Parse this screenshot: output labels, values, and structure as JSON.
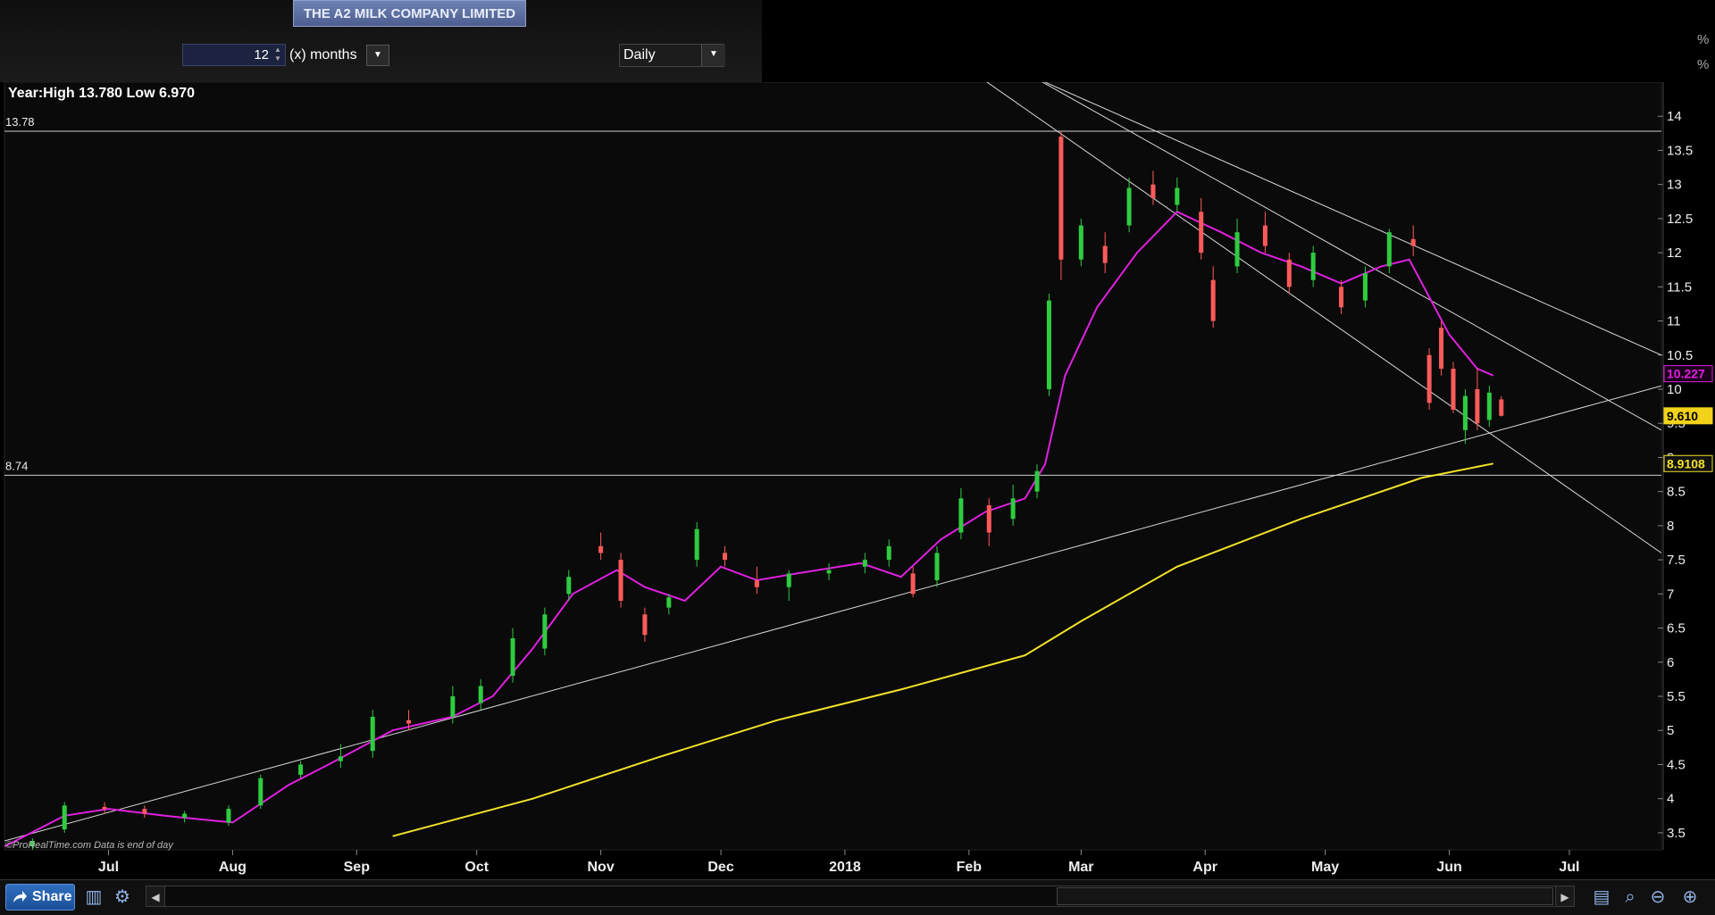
{
  "header": {
    "title": "THE A2 MILK COMPANY LIMITED",
    "period_value": "12",
    "period_unit_label": "(x) months",
    "interval": "Daily",
    "pct_markers": [
      "%",
      "%"
    ]
  },
  "toolbar": {
    "share_label": "Share",
    "icons": [
      "chart-tools-icon",
      "indicator-icon",
      "zoom-fit-icon",
      "zoom-out-icon",
      "zoom-in-icon"
    ]
  },
  "colors": {
    "background": "#0a0a0a",
    "up_candle": "#2ecc40",
    "down_candle": "#ff5a5a",
    "ma_short": "#e020e0",
    "ma_long": "#f2e22a",
    "trendline": "#d8d8d8"
  },
  "chart_data": {
    "type": "candlestick",
    "title": "Year:High 13.780 Low 6.970",
    "watermark": "©ProRealTime.com Data is end of day",
    "year_high": 13.78,
    "year_low": 6.97,
    "ylim": [
      3.25,
      14.5
    ],
    "y_ticks": [
      3.5,
      4,
      4.5,
      5,
      5.5,
      6,
      6.5,
      7,
      7.5,
      8,
      8.5,
      9,
      9.5,
      10,
      10.5,
      11,
      11.5,
      12,
      12.5,
      13,
      13.5,
      14
    ],
    "y_tick_labels": [
      "3.5",
      "4",
      "4.5",
      "5",
      "5.5",
      "6",
      "6.5",
      "7",
      "7.5",
      "8",
      "8.5",
      "9",
      "9.5",
      "10",
      "10.5",
      "11",
      "11.5",
      "12",
      "12.5",
      "13",
      "13.5",
      "14"
    ],
    "x_labels": [
      "Jul",
      "Aug",
      "Sep",
      "Oct",
      "Nov",
      "Dec",
      "2018",
      "Feb",
      "Mar",
      "Apr",
      "May",
      "Jun",
      "Jul"
    ],
    "x_label_dates": [
      "2017-07-01",
      "2017-08-01",
      "2017-09-01",
      "2017-10-01",
      "2017-11-01",
      "2017-12-01",
      "2018-01-01",
      "2018-02-01",
      "2018-03-01",
      "2018-04-01",
      "2018-05-01",
      "2018-06-01",
      "2018-07-01"
    ],
    "x_range": [
      "2017-06-05",
      "2018-07-24"
    ],
    "horizontal_levels": [
      {
        "label": "13.78",
        "value": 13.78
      },
      {
        "label": "8.74",
        "value": 8.74
      }
    ],
    "last_values": [
      {
        "name": "ma_short",
        "label": "10.227",
        "value": 10.227
      },
      {
        "name": "price",
        "label": "9.610",
        "value": 9.61
      },
      {
        "name": "ma_long",
        "label": "8.9108",
        "value": 8.9108
      }
    ],
    "trendlines": [
      {
        "from": [
          "2017-06-05",
          3.38
        ],
        "to": [
          "2018-07-24",
          10.05
        ]
      },
      {
        "from": [
          "2017-12-04",
          17.1
        ],
        "to": [
          "2018-07-24",
          7.6
        ]
      },
      {
        "from": [
          "2018-01-17",
          15.6
        ],
        "to": [
          "2018-07-24",
          9.4
        ]
      },
      {
        "from": [
          "2018-02-20",
          14.5
        ],
        "to": [
          "2018-07-24",
          10.5
        ]
      }
    ],
    "ma_short_points": [
      [
        "2017-06-05",
        3.3
      ],
      [
        "2017-06-20",
        3.75
      ],
      [
        "2017-07-01",
        3.85
      ],
      [
        "2017-07-15",
        3.75
      ],
      [
        "2017-08-01",
        3.65
      ],
      [
        "2017-08-15",
        4.2
      ],
      [
        "2017-08-25",
        4.5
      ],
      [
        "2017-09-10",
        5.0
      ],
      [
        "2017-09-25",
        5.2
      ],
      [
        "2017-10-05",
        5.5
      ],
      [
        "2017-10-15",
        6.2
      ],
      [
        "2017-10-25",
        7.0
      ],
      [
        "2017-11-05",
        7.35
      ],
      [
        "2017-11-12",
        7.1
      ],
      [
        "2017-11-22",
        6.9
      ],
      [
        "2017-12-01",
        7.4
      ],
      [
        "2017-12-10",
        7.2
      ],
      [
        "2017-12-20",
        7.3
      ],
      [
        "2018-01-05",
        7.45
      ],
      [
        "2018-01-15",
        7.25
      ],
      [
        "2018-01-25",
        7.8
      ],
      [
        "2018-02-05",
        8.2
      ],
      [
        "2018-02-15",
        8.4
      ],
      [
        "2018-02-20",
        8.9
      ],
      [
        "2018-02-25",
        10.2
      ],
      [
        "2018-03-05",
        11.2
      ],
      [
        "2018-03-15",
        12.0
      ],
      [
        "2018-03-25",
        12.6
      ],
      [
        "2018-04-05",
        12.3
      ],
      [
        "2018-04-15",
        12.0
      ],
      [
        "2018-04-25",
        11.8
      ],
      [
        "2018-05-05",
        11.55
      ],
      [
        "2018-05-15",
        11.8
      ],
      [
        "2018-05-22",
        11.9
      ],
      [
        "2018-06-01",
        10.8
      ],
      [
        "2018-06-08",
        10.3
      ],
      [
        "2018-06-12",
        10.2
      ]
    ],
    "ma_long_points": [
      [
        "2017-09-10",
        3.45
      ],
      [
        "2017-10-15",
        4.0
      ],
      [
        "2017-11-15",
        4.6
      ],
      [
        "2017-12-15",
        5.15
      ],
      [
        "2018-01-15",
        5.6
      ],
      [
        "2018-02-15",
        6.1
      ],
      [
        "2018-03-01",
        6.6
      ],
      [
        "2018-03-25",
        7.4
      ],
      [
        "2018-04-25",
        8.1
      ],
      [
        "2018-05-25",
        8.7
      ],
      [
        "2018-06-12",
        8.91
      ]
    ],
    "candles": [
      {
        "date": "2017-06-12",
        "open": 3.3,
        "high": 3.42,
        "low": 3.25,
        "close": 3.38
      },
      {
        "date": "2017-06-20",
        "open": 3.55,
        "high": 3.95,
        "low": 3.5,
        "close": 3.9
      },
      {
        "date": "2017-06-30",
        "open": 3.88,
        "high": 3.95,
        "low": 3.78,
        "close": 3.85
      },
      {
        "date": "2017-07-10",
        "open": 3.85,
        "high": 3.9,
        "low": 3.72,
        "close": 3.78
      },
      {
        "date": "2017-07-20",
        "open": 3.72,
        "high": 3.82,
        "low": 3.65,
        "close": 3.78
      },
      {
        "date": "2017-07-31",
        "open": 3.65,
        "high": 3.9,
        "low": 3.6,
        "close": 3.85
      },
      {
        "date": "2017-08-08",
        "open": 3.9,
        "high": 4.35,
        "low": 3.85,
        "close": 4.3
      },
      {
        "date": "2017-08-18",
        "open": 4.35,
        "high": 4.55,
        "low": 4.3,
        "close": 4.5
      },
      {
        "date": "2017-08-28",
        "open": 4.55,
        "high": 4.8,
        "low": 4.45,
        "close": 4.62
      },
      {
        "date": "2017-09-05",
        "open": 4.7,
        "high": 5.3,
        "low": 4.6,
        "close": 5.2
      },
      {
        "date": "2017-09-14",
        "open": 5.15,
        "high": 5.3,
        "low": 5.0,
        "close": 5.1
      },
      {
        "date": "2017-09-25",
        "open": 5.2,
        "high": 5.65,
        "low": 5.1,
        "close": 5.5
      },
      {
        "date": "2017-10-02",
        "open": 5.4,
        "high": 5.75,
        "low": 5.3,
        "close": 5.65
      },
      {
        "date": "2017-10-10",
        "open": 5.8,
        "high": 6.5,
        "low": 5.7,
        "close": 6.35
      },
      {
        "date": "2017-10-18",
        "open": 6.2,
        "high": 6.8,
        "low": 6.1,
        "close": 6.7
      },
      {
        "date": "2017-10-24",
        "open": 7.0,
        "high": 7.35,
        "low": 6.9,
        "close": 7.25
      },
      {
        "date": "2017-11-01",
        "open": 7.7,
        "high": 7.9,
        "low": 7.5,
        "close": 7.6
      },
      {
        "date": "2017-11-06",
        "open": 7.5,
        "high": 7.6,
        "low": 6.8,
        "close": 6.9
      },
      {
        "date": "2017-11-12",
        "open": 6.7,
        "high": 6.8,
        "low": 6.3,
        "close": 6.4
      },
      {
        "date": "2017-11-18",
        "open": 6.8,
        "high": 7.0,
        "low": 6.7,
        "close": 6.95
      },
      {
        "date": "2017-11-25",
        "open": 7.5,
        "high": 8.05,
        "low": 7.4,
        "close": 7.95
      },
      {
        "date": "2017-12-02",
        "open": 7.6,
        "high": 7.7,
        "low": 7.4,
        "close": 7.5
      },
      {
        "date": "2017-12-10",
        "open": 7.2,
        "high": 7.4,
        "low": 7.0,
        "close": 7.1
      },
      {
        "date": "2017-12-18",
        "open": 7.1,
        "high": 7.35,
        "low": 6.9,
        "close": 7.3
      },
      {
        "date": "2017-12-28",
        "open": 7.3,
        "high": 7.45,
        "low": 7.2,
        "close": 7.35
      },
      {
        "date": "2018-01-06",
        "open": 7.4,
        "high": 7.6,
        "low": 7.3,
        "close": 7.5
      },
      {
        "date": "2018-01-12",
        "open": 7.5,
        "high": 7.8,
        "low": 7.4,
        "close": 7.7
      },
      {
        "date": "2018-01-18",
        "open": 7.3,
        "high": 7.4,
        "low": 6.95,
        "close": 7.0
      },
      {
        "date": "2018-01-24",
        "open": 7.2,
        "high": 7.7,
        "low": 7.1,
        "close": 7.6
      },
      {
        "date": "2018-01-30",
        "open": 7.9,
        "high": 8.55,
        "low": 7.8,
        "close": 8.4
      },
      {
        "date": "2018-02-06",
        "open": 8.3,
        "high": 8.4,
        "low": 7.7,
        "close": 7.9
      },
      {
        "date": "2018-02-12",
        "open": 8.1,
        "high": 8.6,
        "low": 8.0,
        "close": 8.4
      },
      {
        "date": "2018-02-18",
        "open": 8.5,
        "high": 8.9,
        "low": 8.4,
        "close": 8.8
      },
      {
        "date": "2018-02-21",
        "open": 10.0,
        "high": 11.4,
        "low": 9.9,
        "close": 11.3
      },
      {
        "date": "2018-02-24",
        "open": 13.7,
        "high": 13.78,
        "low": 11.6,
        "close": 11.9
      },
      {
        "date": "2018-03-01",
        "open": 11.9,
        "high": 12.5,
        "low": 11.8,
        "close": 12.4
      },
      {
        "date": "2018-03-07",
        "open": 12.1,
        "high": 12.3,
        "low": 11.7,
        "close": 11.85
      },
      {
        "date": "2018-03-13",
        "open": 12.4,
        "high": 13.1,
        "low": 12.3,
        "close": 12.95
      },
      {
        "date": "2018-03-19",
        "open": 13.0,
        "high": 13.2,
        "low": 12.7,
        "close": 12.8
      },
      {
        "date": "2018-03-25",
        "open": 12.7,
        "high": 13.1,
        "low": 12.6,
        "close": 12.95
      },
      {
        "date": "2018-03-31",
        "open": 12.6,
        "high": 12.8,
        "low": 11.9,
        "close": 12.0
      },
      {
        "date": "2018-04-03",
        "open": 11.6,
        "high": 11.8,
        "low": 10.9,
        "close": 11.0
      },
      {
        "date": "2018-04-09",
        "open": 11.8,
        "high": 12.5,
        "low": 11.7,
        "close": 12.3
      },
      {
        "date": "2018-04-16",
        "open": 12.4,
        "high": 12.6,
        "low": 12.0,
        "close": 12.1
      },
      {
        "date": "2018-04-22",
        "open": 11.9,
        "high": 12.0,
        "low": 11.4,
        "close": 11.5
      },
      {
        "date": "2018-04-28",
        "open": 11.6,
        "high": 12.1,
        "low": 11.5,
        "close": 12.0
      },
      {
        "date": "2018-05-05",
        "open": 11.5,
        "high": 11.6,
        "low": 11.1,
        "close": 11.2
      },
      {
        "date": "2018-05-11",
        "open": 11.3,
        "high": 11.8,
        "low": 11.2,
        "close": 11.7
      },
      {
        "date": "2018-05-17",
        "open": 11.8,
        "high": 12.35,
        "low": 11.7,
        "close": 12.3
      },
      {
        "date": "2018-05-23",
        "open": 12.2,
        "high": 12.4,
        "low": 11.95,
        "close": 12.1
      },
      {
        "date": "2018-05-27",
        "open": 10.5,
        "high": 10.6,
        "low": 9.7,
        "close": 9.8
      },
      {
        "date": "2018-05-30",
        "open": 10.9,
        "high": 11.0,
        "low": 10.2,
        "close": 10.3
      },
      {
        "date": "2018-06-02",
        "open": 10.3,
        "high": 10.4,
        "low": 9.65,
        "close": 9.7
      },
      {
        "date": "2018-06-05",
        "open": 9.4,
        "high": 10.0,
        "low": 9.2,
        "close": 9.9
      },
      {
        "date": "2018-06-08",
        "open": 10.0,
        "high": 10.3,
        "low": 9.4,
        "close": 9.5
      },
      {
        "date": "2018-06-11",
        "open": 9.55,
        "high": 10.05,
        "low": 9.45,
        "close": 9.95
      },
      {
        "date": "2018-06-14",
        "open": 9.85,
        "high": 9.9,
        "low": 9.6,
        "close": 9.61
      }
    ]
  }
}
